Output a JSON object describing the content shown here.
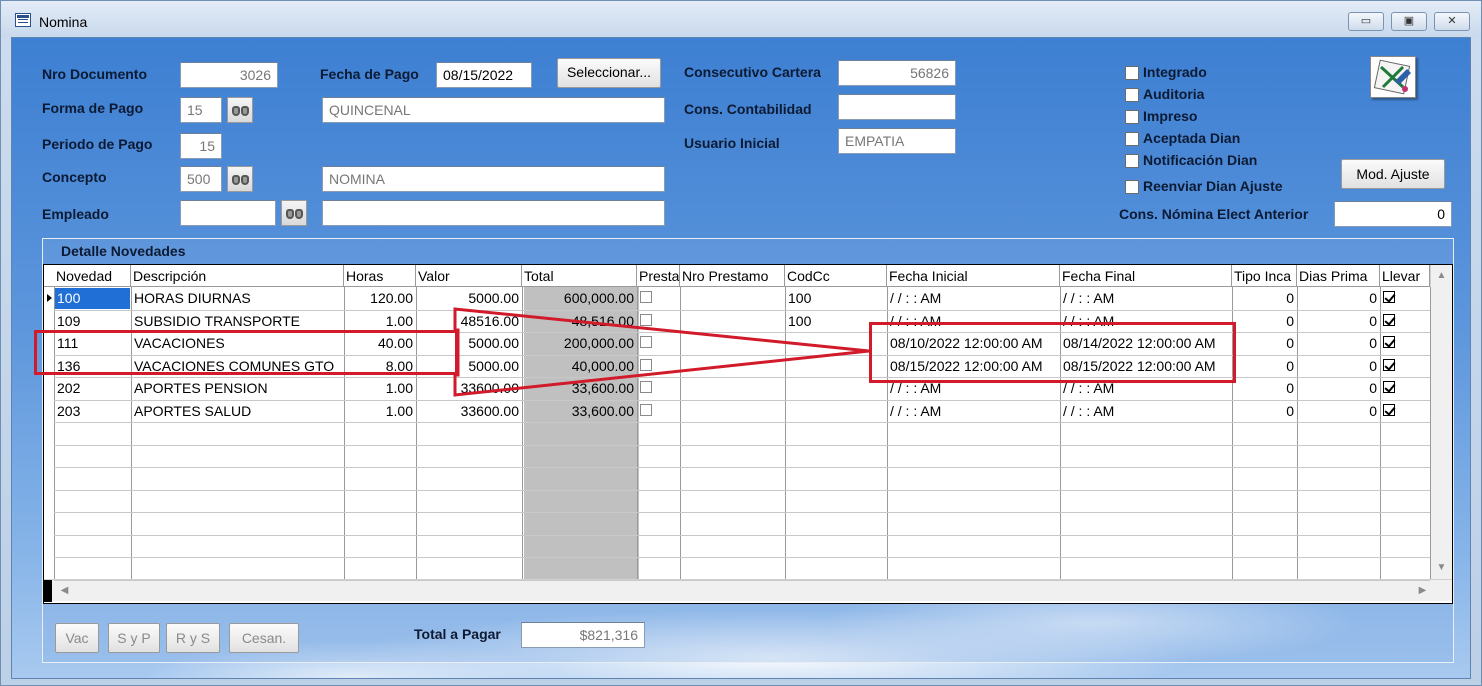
{
  "window": {
    "title": "Nomina",
    "controls": {
      "minimize": "▭",
      "restore": "▣",
      "close": "✕"
    }
  },
  "form": {
    "nro_documento": {
      "label": "Nro Documento",
      "value": "3026"
    },
    "fecha_pago": {
      "label": "Fecha de Pago",
      "value": "08/15/2022"
    },
    "seleccionar_label": "Seleccionar...",
    "consecutivo_cartera": {
      "label": "Consecutivo Cartera",
      "value": "56826"
    },
    "forma_pago": {
      "label": "Forma de Pago",
      "code": "15",
      "name": "QUINCENAL"
    },
    "cons_contabilidad": {
      "label": "Cons. Contabilidad",
      "value": ""
    },
    "periodo_pago": {
      "label": "Periodo de Pago",
      "value": "15"
    },
    "usuario_inicial": {
      "label": "Usuario Inicial",
      "value": "EMPATIA"
    },
    "concepto": {
      "label": "Concepto",
      "code": "500",
      "name": "NOMINA"
    },
    "empleado": {
      "label": "Empleado",
      "code": "",
      "name": ""
    },
    "checkboxes": [
      {
        "label": "Integrado",
        "checked": false
      },
      {
        "label": "Auditoria",
        "checked": false
      },
      {
        "label": "Impreso",
        "checked": false
      },
      {
        "label": "Aceptada Dian",
        "checked": false
      },
      {
        "label": "Notificación Dian",
        "checked": false
      },
      {
        "label": "Reenviar Dian Ajuste",
        "checked": false
      }
    ],
    "mod_ajuste_label": "Mod. Ajuste",
    "cons_nomina_elect": {
      "label": "Cons. Nómina Elect Anterior",
      "value": "0"
    }
  },
  "grid": {
    "title": "Detalle Novedades",
    "columns": [
      "Novedad",
      "Descripción",
      "Horas",
      "Valor",
      "Total",
      "Presta",
      "Nro Prestamo",
      "CodCc",
      "Fecha Inicial",
      "Fecha Final",
      "Tipo Inca",
      "Dias Prima",
      "Llevar"
    ],
    "rows": [
      {
        "novedad": "100",
        "descripcion": "HORAS DIURNAS",
        "horas": "120.00",
        "valor": "5000.00",
        "total": "600,000.00",
        "codcc": "100",
        "fecha_inicial": "/ /     : :  AM",
        "fecha_final": "/ /     : :  AM",
        "tipo_inca": "0",
        "dias_prima": "0",
        "presta": false,
        "llevar": true
      },
      {
        "novedad": "109",
        "descripcion": "SUBSIDIO TRANSPORTE",
        "horas": "1.00",
        "valor": "48516.00",
        "total": "48,516.00",
        "codcc": "100",
        "fecha_inicial": "/ /     : :  AM",
        "fecha_final": "/ /     : :  AM",
        "tipo_inca": "0",
        "dias_prima": "0",
        "presta": false,
        "llevar": true
      },
      {
        "novedad": "111",
        "descripcion": "VACACIONES",
        "horas": "40.00",
        "valor": "5000.00",
        "total": "200,000.00",
        "codcc": "",
        "fecha_inicial": "08/10/2022 12:00:00 AM",
        "fecha_final": "08/14/2022 12:00:00 AM",
        "tipo_inca": "0",
        "dias_prima": "0",
        "presta": false,
        "llevar": true
      },
      {
        "novedad": "136",
        "descripcion": "VACACIONES COMUNES GTO",
        "horas": "8.00",
        "valor": "5000.00",
        "total": "40,000.00",
        "codcc": "",
        "fecha_inicial": "08/15/2022 12:00:00 AM",
        "fecha_final": "08/15/2022 12:00:00 AM",
        "tipo_inca": "0",
        "dias_prima": "0",
        "presta": false,
        "llevar": true
      },
      {
        "novedad": "202",
        "descripcion": "APORTES PENSION",
        "horas": "1.00",
        "valor": "33600.00",
        "total": "33,600.00",
        "codcc": "",
        "fecha_inicial": "/ /     : :  AM",
        "fecha_final": "/ /     : :  AM",
        "tipo_inca": "0",
        "dias_prima": "0",
        "presta": false,
        "llevar": true
      },
      {
        "novedad": "203",
        "descripcion": "APORTES SALUD",
        "horas": "1.00",
        "valor": "33600.00",
        "total": "33,600.00",
        "codcc": "",
        "fecha_inicial": "/ /     : :  AM",
        "fecha_final": "/ /     : :  AM",
        "tipo_inca": "0",
        "dias_prima": "0",
        "presta": false,
        "llevar": true
      }
    ],
    "empty_rows": 7
  },
  "footer": {
    "buttons": [
      "Vac",
      "S y P",
      "R y S",
      "Cesan."
    ],
    "total_label": "Total a Pagar",
    "total_value": "$821,316"
  },
  "annotation": {
    "color": "#d11a2a"
  },
  "icons": {
    "title": "table-icon",
    "search": "binoculars-icon",
    "mod": "edit-document-icon",
    "row_pointer": "row-pointer-icon"
  }
}
